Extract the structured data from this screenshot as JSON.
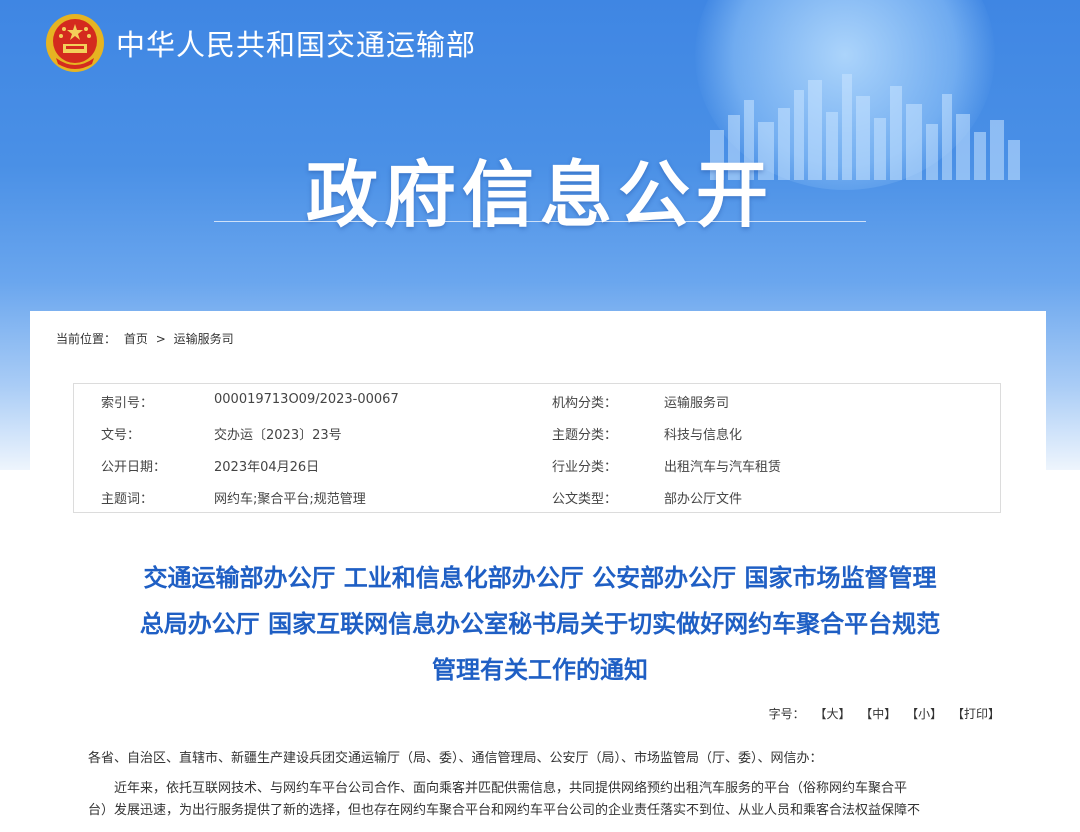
{
  "header": {
    "ministry_name": "中华人民共和国交通运输部",
    "banner_title": "政府信息公开",
    "emblem_icon": "national-emblem-icon",
    "brand_color": "#4a90e6"
  },
  "breadcrumb": {
    "label": "当前位置：",
    "home": "首页",
    "separator": ">",
    "current": "运输服务司"
  },
  "info": {
    "rows": [
      {
        "k1": "索引号：",
        "v1": "000019713O09/2023-00067",
        "k2": "机构分类：",
        "v2": "运输服务司"
      },
      {
        "k1": "文号：",
        "v1": "交办运〔2023〕23号",
        "k2": "主题分类：",
        "v2": "科技与信息化"
      },
      {
        "k1": "公开日期：",
        "v1": "2023年04月26日",
        "k2": "行业分类：",
        "v2": "出租汽车与汽车租赁"
      },
      {
        "k1": "主题词：",
        "v1": "网约车;聚合平台;规范管理",
        "k2": "公文类型：",
        "v2": "部办公厅文件"
      }
    ]
  },
  "document": {
    "title_lines": [
      "交通运输部办公厅 工业和信息化部办公厅 公安部办公厅 国家市场监督管理",
      "总局办公厅 国家互联网信息办公室秘书局关于切实做好网约车聚合平台规范",
      "管理有关工作的通知"
    ],
    "title_color": "#1f5fc4"
  },
  "font_size": {
    "label": "字号：",
    "large": "【大】",
    "medium": "【中】",
    "small": "【小】",
    "print": "【打印】"
  },
  "body": {
    "recipients": "各省、自治区、直辖市、新疆生产建设兵团交通运输厅（局、委）、通信管理局、公安厅（局）、市场监管局（厅、委）、网信办：",
    "paragraph1_line1": "近年来，依托互联网技术、与网约车平台公司合作、面向乘客并匹配供需信息，共同提供网络预约出租汽车服务的平台（俗称网约车聚合平",
    "paragraph1_line2": "台）发展迅速，为出行服务提供了新的选择，但也存在网约车聚合平台和网约车平台公司的企业责任落实不到位、从业人员和乘客合法权益保障不"
  }
}
